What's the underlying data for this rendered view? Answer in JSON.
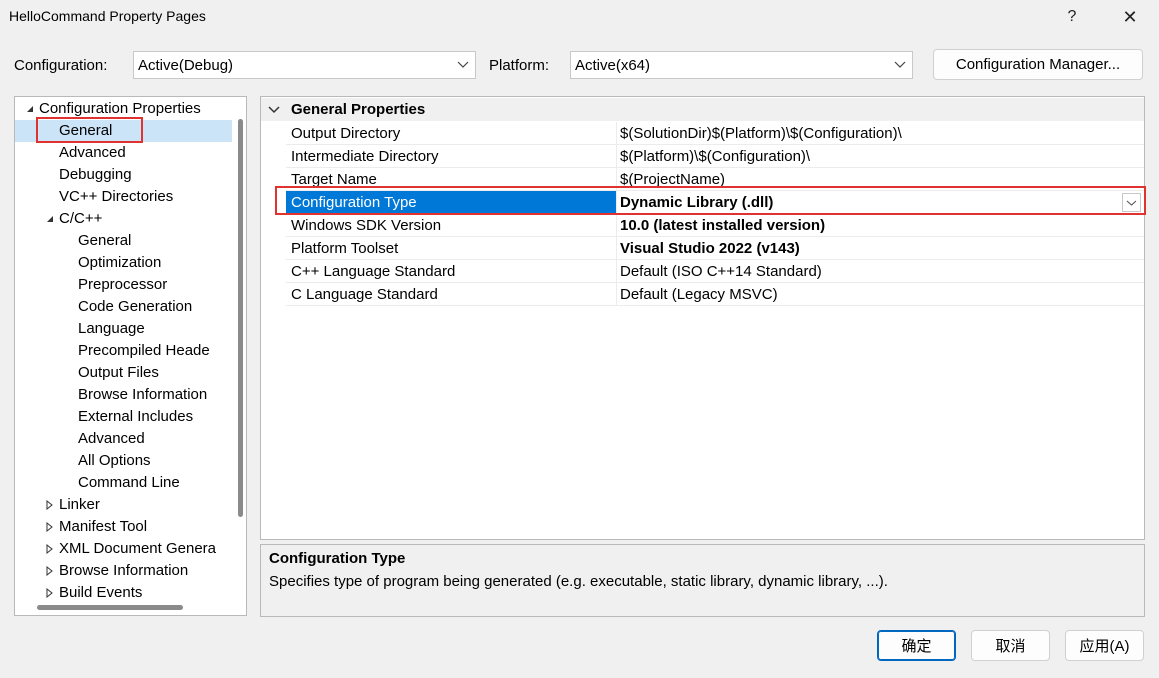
{
  "window": {
    "title": "HelloCommand Property Pages",
    "help_label": "?",
    "close_label": "✕"
  },
  "config_bar": {
    "configuration_label": "Configuration:",
    "configuration_value": "Active(Debug)",
    "platform_label": "Platform:",
    "platform_value": "Active(x64)",
    "config_manager_label": "Configuration Manager..."
  },
  "tree": {
    "items": [
      {
        "label": "Configuration Properties",
        "expander": "expanded"
      },
      {
        "label": "General",
        "selected": true
      },
      {
        "label": "Advanced"
      },
      {
        "label": "Debugging"
      },
      {
        "label": "VC++ Directories"
      },
      {
        "label": "C/C++",
        "expander": "expanded"
      },
      {
        "label": "General"
      },
      {
        "label": "Optimization"
      },
      {
        "label": "Preprocessor"
      },
      {
        "label": "Code Generation"
      },
      {
        "label": "Language"
      },
      {
        "label": "Precompiled Heade"
      },
      {
        "label": "Output Files"
      },
      {
        "label": "Browse Information"
      },
      {
        "label": "External Includes"
      },
      {
        "label": "Advanced"
      },
      {
        "label": "All Options"
      },
      {
        "label": "Command Line"
      },
      {
        "label": "Linker",
        "expander": "collapsed"
      },
      {
        "label": "Manifest Tool",
        "expander": "collapsed"
      },
      {
        "label": "XML Document Genera",
        "expander": "collapsed"
      },
      {
        "label": "Browse Information",
        "expander": "collapsed"
      },
      {
        "label": "Build Events",
        "expander": "collapsed"
      }
    ]
  },
  "grid": {
    "category": "General Properties",
    "rows": [
      {
        "name": "Output Directory",
        "value": "$(SolutionDir)$(Platform)\\$(Configuration)\\"
      },
      {
        "name": "Intermediate Directory",
        "value": "$(Platform)\\$(Configuration)\\"
      },
      {
        "name": "Target Name",
        "value": "$(ProjectName)"
      },
      {
        "name": "Configuration Type",
        "value": "Dynamic Library (.dll)",
        "bold": true,
        "selected": true
      },
      {
        "name": "Windows SDK Version",
        "value": "10.0 (latest installed version)",
        "bold": true
      },
      {
        "name": "Platform Toolset",
        "value": "Visual Studio 2022 (v143)",
        "bold": true
      },
      {
        "name": "C++ Language Standard",
        "value": "Default (ISO C++14 Standard)"
      },
      {
        "name": "C Language Standard",
        "value": "Default (Legacy MSVC)"
      }
    ]
  },
  "description": {
    "title": "Configuration Type",
    "text": "Specifies type of program being generated (e.g. executable, static library, dynamic library, ...)."
  },
  "buttons": {
    "ok": "确定",
    "cancel": "取消",
    "apply": "应用(A)"
  },
  "colors": {
    "selection": "#0078d7",
    "annotation_box": "#e0322f"
  }
}
